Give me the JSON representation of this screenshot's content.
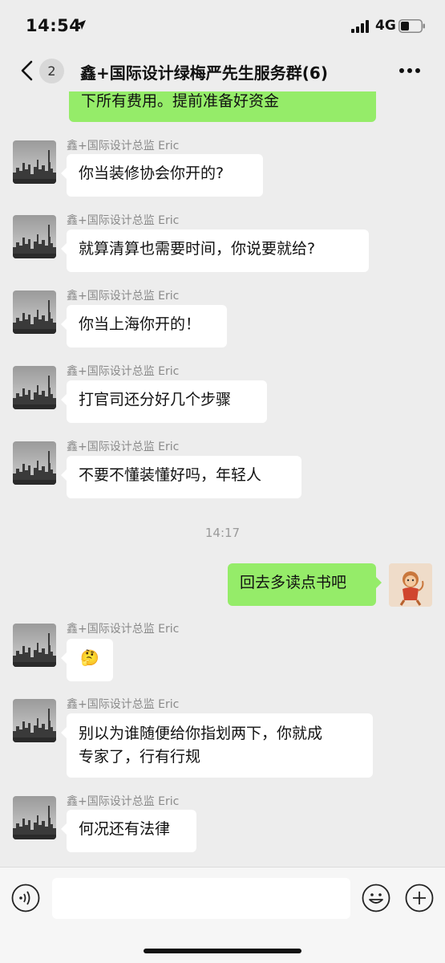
{
  "status_bar": {
    "time": "14:54",
    "network": "4G"
  },
  "nav": {
    "unread_count": "2",
    "title": "鑫+国际设计绿梅严先生服务群(6)"
  },
  "messages": [
    {
      "text": "下所有费用。提前准备好资金"
    },
    {
      "sender": "鑫+国际设计总监 Eric",
      "text": "你当装修协会你开的?"
    },
    {
      "sender": "鑫+国际设计总监 Eric",
      "text": "就算清算也需要时间，你说要就给?"
    },
    {
      "sender": "鑫+国际设计总监 Eric",
      "text": "你当上海你开的！"
    },
    {
      "sender": "鑫+国际设计总监 Eric",
      "text": "打官司还分好几个步骤"
    },
    {
      "sender": "鑫+国际设计总监 Eric",
      "text": "不要不懂装懂好吗，年轻人"
    },
    {
      "timestamp": "14:17"
    },
    {
      "text": "回去多读点书吧"
    },
    {
      "sender": "鑫+国际设计总监 Eric",
      "emoji": "🤔"
    },
    {
      "sender": "鑫+国际设计总监 Eric",
      "lines": [
        "别以为谁随便给你指划两下，你就成",
        "专家了，行有行规"
      ]
    },
    {
      "sender": "鑫+国际设计总监 Eric",
      "text": "何况还有法律"
    }
  ],
  "colors": {
    "sent_bubble": "#95ec69",
    "received_bubble": "#ffffff",
    "background": "#ededed"
  },
  "icons": {
    "back": "chevron-left-icon",
    "more": "more-dots-icon",
    "voice": "voice-icon",
    "emoji": "emoji-icon",
    "add": "plus-icon"
  }
}
